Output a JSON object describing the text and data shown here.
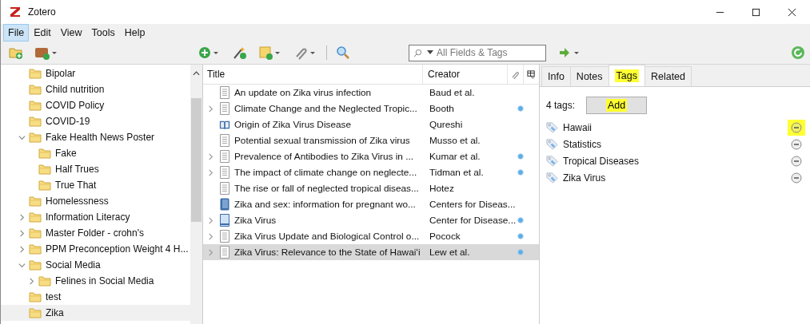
{
  "window": {
    "title": "Zotero"
  },
  "menu": [
    {
      "label": "File",
      "selected": true
    },
    {
      "label": "Edit",
      "selected": false
    },
    {
      "label": "View",
      "selected": false
    },
    {
      "label": "Tools",
      "selected": false
    },
    {
      "label": "Help",
      "selected": false
    }
  ],
  "search": {
    "placeholder": "All Fields & Tags"
  },
  "collections": [
    {
      "label": "Bipolar",
      "selected": false
    },
    {
      "label": "Child nutrition",
      "selected": false
    },
    {
      "label": "COVID Policy",
      "selected": false
    },
    {
      "label": "COVID-19",
      "selected": false
    },
    {
      "label": "Fake Health News Poster",
      "selected": false,
      "expanded": true,
      "children": [
        {
          "label": "Fake",
          "selected": false
        },
        {
          "label": "Half Trues",
          "selected": false
        },
        {
          "label": "True That",
          "selected": false
        }
      ]
    },
    {
      "label": "Homelessness",
      "selected": false
    },
    {
      "label": "Information Literacy",
      "selected": false,
      "expanded": false
    },
    {
      "label": "Master Folder - crohn's",
      "selected": false,
      "expanded": false
    },
    {
      "label": "PPM Preconception Weight 4 H...",
      "selected": false,
      "expanded": false
    },
    {
      "label": "Social Media",
      "selected": false,
      "expanded": true,
      "children": [
        {
          "label": "Felines in Social Media",
          "selected": false,
          "expanded": false
        }
      ]
    },
    {
      "label": "test",
      "selected": false
    },
    {
      "label": "Zika",
      "selected": true
    }
  ],
  "items_table": {
    "columns": [
      "Title",
      "Creator"
    ],
    "rows": [
      {
        "kind": "document",
        "title": "An update on Zika virus infection",
        "creator": "Baud et al.",
        "expandable": false,
        "attachment": false,
        "selected": false
      },
      {
        "kind": "document",
        "title": "Climate Change and the Neglected Tropic...",
        "creator": "Booth",
        "expandable": true,
        "attachment": true,
        "selected": false
      },
      {
        "kind": "book-section",
        "title": "Origin of Zika Virus Disease",
        "creator": "Qureshi",
        "expandable": false,
        "attachment": false,
        "selected": false
      },
      {
        "kind": "document",
        "title": "Potential sexual transmission of Zika virus",
        "creator": "Musso et al.",
        "expandable": false,
        "attachment": false,
        "selected": false
      },
      {
        "kind": "document",
        "title": "Prevalence of Antibodies to Zika Virus in ...",
        "creator": "Kumar et al.",
        "expandable": true,
        "attachment": true,
        "selected": false
      },
      {
        "kind": "document",
        "title": "The impact of climate change on neglecte...",
        "creator": "Tidman et al.",
        "expandable": true,
        "attachment": true,
        "selected": false
      },
      {
        "kind": "document",
        "title": "The rise or fall of neglected tropical diseas...",
        "creator": "Hotez",
        "expandable": false,
        "attachment": false,
        "selected": false
      },
      {
        "kind": "book",
        "title": "Zika and sex: information for pregnant wo...",
        "creator": "Centers for Diseas...",
        "expandable": false,
        "attachment": false,
        "selected": false
      },
      {
        "kind": "web-page",
        "title": "Zika Virus",
        "creator": "Center for Disease...",
        "expandable": true,
        "attachment": true,
        "selected": false
      },
      {
        "kind": "document",
        "title": "Zika Virus Update and Biological Control o...",
        "creator": "Pocock",
        "expandable": true,
        "attachment": true,
        "selected": false
      },
      {
        "kind": "document",
        "title": "Zika Virus: Relevance to the State of Hawaiʻi",
        "creator": "Lew et al.",
        "expandable": true,
        "attachment": true,
        "selected": true
      }
    ]
  },
  "item_pane": {
    "tabs": [
      {
        "label": "Info",
        "selected": false,
        "highlighted": false
      },
      {
        "label": "Notes",
        "selected": false,
        "highlighted": false
      },
      {
        "label": "Tags",
        "selected": true,
        "highlighted": true
      },
      {
        "label": "Related",
        "selected": false,
        "highlighted": false
      }
    ],
    "tag_count": "4 tags:",
    "add_button": {
      "label": "Add",
      "highlighted": true
    },
    "tags": [
      {
        "label": "Hawaii",
        "highlighted": true
      },
      {
        "label": "Statistics",
        "highlighted": false
      },
      {
        "label": "Tropical Diseases",
        "highlighted": false
      },
      {
        "label": "Zika Virus",
        "highlighted": false
      }
    ]
  }
}
